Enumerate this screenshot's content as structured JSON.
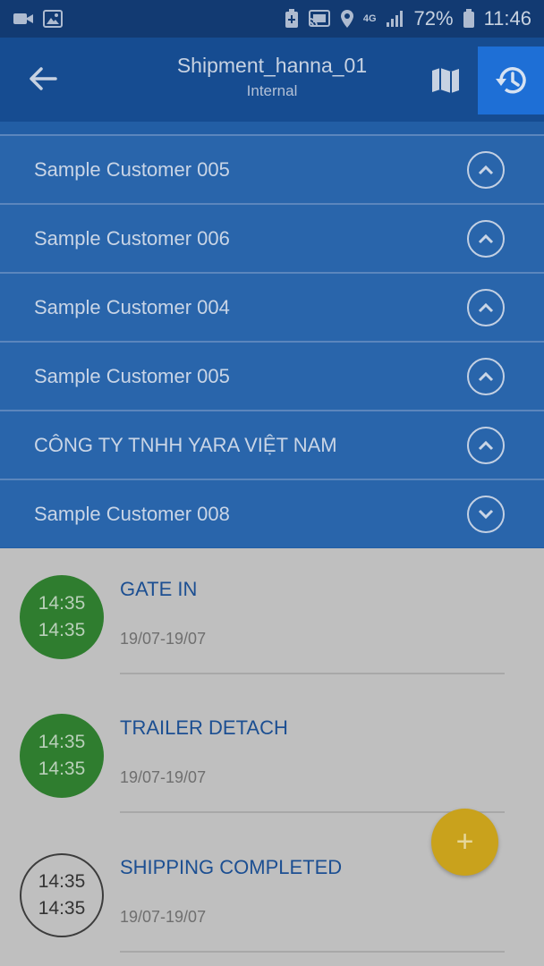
{
  "status_bar": {
    "battery_percent": "72%",
    "time": "11:46",
    "network": "4G",
    "icons": [
      "video-icon",
      "image-icon",
      "battery-saver-icon",
      "cast-icon",
      "location-icon",
      "signal-icon",
      "battery-icon"
    ]
  },
  "app_bar": {
    "title": "Shipment_hanna_01",
    "subtitle": "Internal",
    "icons": [
      "back-arrow-icon",
      "map-icon",
      "history-icon"
    ],
    "colors": {
      "background": "#164c91",
      "active_button": "#1e6fd6"
    }
  },
  "customers": [
    {
      "name": "Sample Customer 005",
      "expanded": true
    },
    {
      "name": "Sample Customer 006",
      "expanded": true
    },
    {
      "name": "Sample Customer 004",
      "expanded": true
    },
    {
      "name": "Sample Customer 005",
      "expanded": true
    },
    {
      "name": "CÔNG TY TNHH YARA VIỆT NAM",
      "expanded": true
    },
    {
      "name": "Sample Customer 008",
      "expanded": false
    }
  ],
  "events": [
    {
      "time_start": "14:35",
      "time_end": "14:35",
      "title": "GATE IN",
      "dates": "19/07-19/07",
      "status": "done"
    },
    {
      "time_start": "14:35",
      "time_end": "14:35",
      "title": "TRAILER DETACH",
      "dates": "19/07-19/07",
      "status": "done"
    },
    {
      "time_start": "14:35",
      "time_end": "14:35",
      "title": "SHIPPING COMPLETED",
      "dates": "19/07-19/07",
      "status": "pending"
    }
  ],
  "fab": {
    "label": "+",
    "color": "#c9a21c"
  }
}
